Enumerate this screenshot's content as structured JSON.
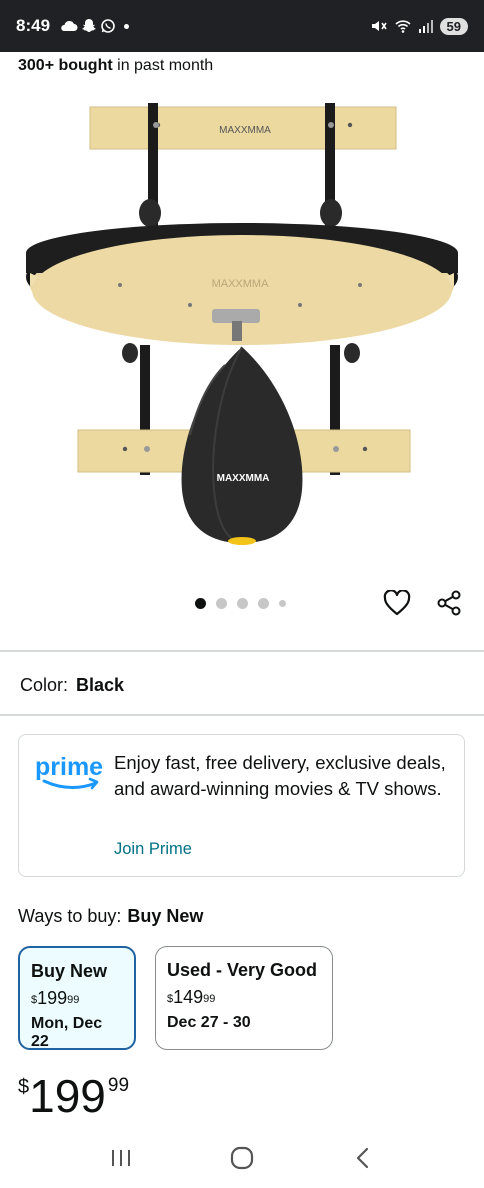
{
  "status_bar": {
    "time": "8:49",
    "battery": "59",
    "left_icons": [
      "cloud-icon",
      "snapchat-icon",
      "whatsapp-icon",
      "dot-icon"
    ],
    "right_icons": [
      "mute-icon",
      "wifi-icon",
      "signal-icon",
      "battery-icon"
    ]
  },
  "product": {
    "bought_count": "300+ bought",
    "bought_suffix": " in past month",
    "image_alt": "MAXXMMA speed bag platform with speed bag",
    "brand_text": "MAXXMMA",
    "carousel": {
      "count": 5,
      "active_index": 0
    }
  },
  "actions": {
    "wishlist_icon": "heart-icon",
    "share_icon": "share-icon"
  },
  "color": {
    "label": "Color:",
    "value": "Black"
  },
  "prime": {
    "logo_text": "prime",
    "message": "Enjoy fast, free delivery, exclusive deals, and award-winning movies & TV shows.",
    "link": "Join Prime"
  },
  "ways_to_buy": {
    "label": "Ways to buy:",
    "selected": "Buy New",
    "options": [
      {
        "title": "Buy New",
        "price_symbol": "$",
        "price_whole": "199",
        "price_fraction": "99",
        "delivery": "Mon, Dec 22",
        "selected": true
      },
      {
        "title": "Used - Very Good",
        "price_symbol": "$",
        "price_whole": "149",
        "price_fraction": "99",
        "delivery": "Dec 27 - 30",
        "selected": false
      }
    ]
  },
  "price": {
    "symbol": "$",
    "whole": "199",
    "fraction": "99"
  },
  "nav": {
    "recents_icon": "recents-icon",
    "home_icon": "home-icon",
    "back_icon": "back-icon"
  },
  "colors": {
    "accent_link": "#007185",
    "selected_border": "#2162a1",
    "selected_bg": "#edfdff",
    "prime_blue": "#1a98ff"
  }
}
